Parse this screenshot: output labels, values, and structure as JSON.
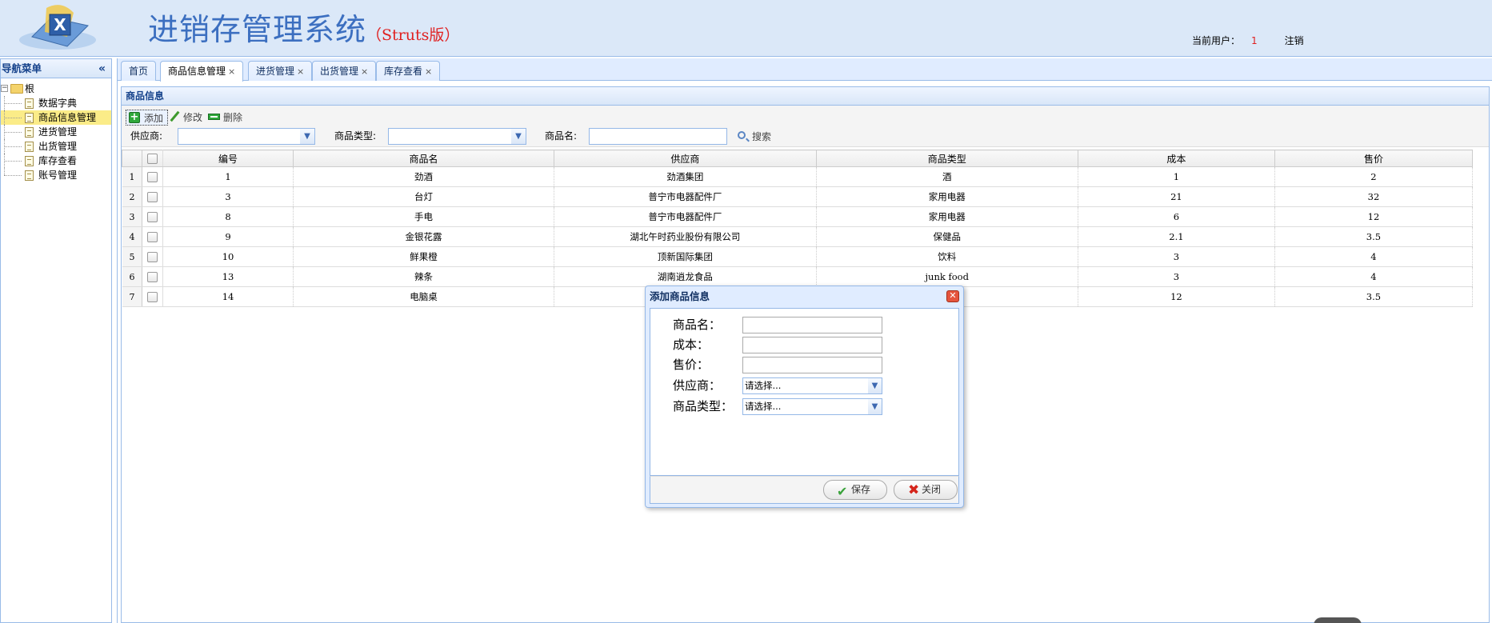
{
  "header": {
    "title": "进销存管理系统",
    "subtitle": "（Struts版）",
    "current_user_label": "当前用户：",
    "current_user": "1",
    "logout": "注销"
  },
  "nav": {
    "title": "导航菜单",
    "collapse_icon": "«",
    "root": "根",
    "items": [
      {
        "label": "数据字典"
      },
      {
        "label": "商品信息管理"
      },
      {
        "label": "进货管理"
      },
      {
        "label": "出货管理"
      },
      {
        "label": "库存查看"
      },
      {
        "label": "账号管理"
      }
    ]
  },
  "tabs": [
    {
      "label": "首页"
    },
    {
      "label": "商品信息管理"
    },
    {
      "label": "进货管理"
    },
    {
      "label": "出货管理"
    },
    {
      "label": "库存查看"
    }
  ],
  "tab_close": "×",
  "panel": {
    "title": "商品信息",
    "toolbar": {
      "add": "添加",
      "edit": "修改",
      "delete": "删除"
    },
    "filters": {
      "supplier_label": "供应商:",
      "type_label": "商品类型:",
      "name_label": "商品名:",
      "search": "搜索"
    }
  },
  "grid": {
    "columns": [
      "编号",
      "商品名",
      "供应商",
      "商品类型",
      "成本",
      "售价"
    ],
    "rows": [
      {
        "rn": "1",
        "id": "1",
        "name": "劲酒",
        "supplier": "劲酒集团",
        "type": "酒",
        "cost": "1",
        "price": "2"
      },
      {
        "rn": "2",
        "id": "3",
        "name": "台灯",
        "supplier": "普宁市电器配件厂",
        "type": "家用电器",
        "cost": "21",
        "price": "32"
      },
      {
        "rn": "3",
        "id": "8",
        "name": "手电",
        "supplier": "普宁市电器配件厂",
        "type": "家用电器",
        "cost": "6",
        "price": "12"
      },
      {
        "rn": "4",
        "id": "9",
        "name": "金银花露",
        "supplier": "湖北午时药业股份有限公司",
        "type": "保健品",
        "cost": "2.1",
        "price": "3.5"
      },
      {
        "rn": "5",
        "id": "10",
        "name": "鲜果橙",
        "supplier": "顶新国际集团",
        "type": "饮料",
        "cost": "3",
        "price": "4"
      },
      {
        "rn": "6",
        "id": "13",
        "name": "辣条",
        "supplier": "湖南逍龙食品",
        "type": "junk food",
        "cost": "3",
        "price": "4"
      },
      {
        "rn": "7",
        "id": "14",
        "name": "电脑桌",
        "supplier": "",
        "type": "",
        "cost": "12",
        "price": "3.5"
      }
    ]
  },
  "dialog": {
    "title": "添加商品信息",
    "close_icon": "✕",
    "fields": {
      "name": "商品名：",
      "cost": "成本：",
      "price": "售价：",
      "supplier": "供应商：",
      "type": "商品类型："
    },
    "select_placeholder": "请选择...",
    "save": "保存",
    "close": "关闭"
  },
  "icons": {
    "ok": "✔",
    "cancel": "✖",
    "dropdown": "▼"
  }
}
